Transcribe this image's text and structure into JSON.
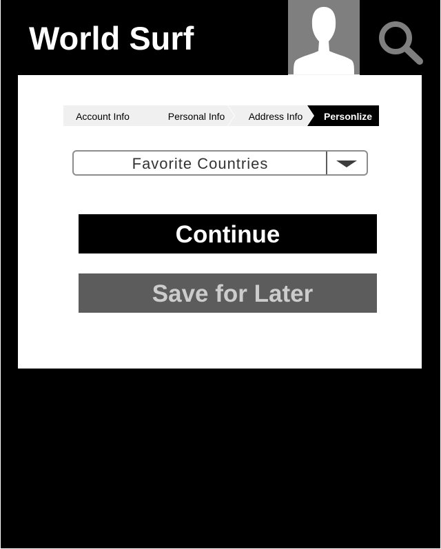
{
  "header": {
    "title": "World Surf",
    "avatar_icon": "user-silhouette-icon",
    "search_icon": "search-icon"
  },
  "breadcrumb": {
    "steps": [
      {
        "label": "Account Info",
        "active": false
      },
      {
        "label": "Personal Info",
        "active": false
      },
      {
        "label": "Address Info",
        "active": false
      },
      {
        "label": "Personlize",
        "active": true
      }
    ]
  },
  "form": {
    "dropdown": {
      "value": "Favorite Countries",
      "toggle_icon": "chevron-down-icon"
    },
    "continue_label": "Continue",
    "save_label": "Save for Later"
  },
  "colors": {
    "background": "#000000",
    "panel": "#ffffff",
    "avatar_bg": "#7f7f7f",
    "crumb_inactive": "#f0f0f0",
    "crumb_active": "#000000",
    "continue_button": "#000000",
    "save_button": "#5c5c5c",
    "save_text": "#cccccc"
  }
}
